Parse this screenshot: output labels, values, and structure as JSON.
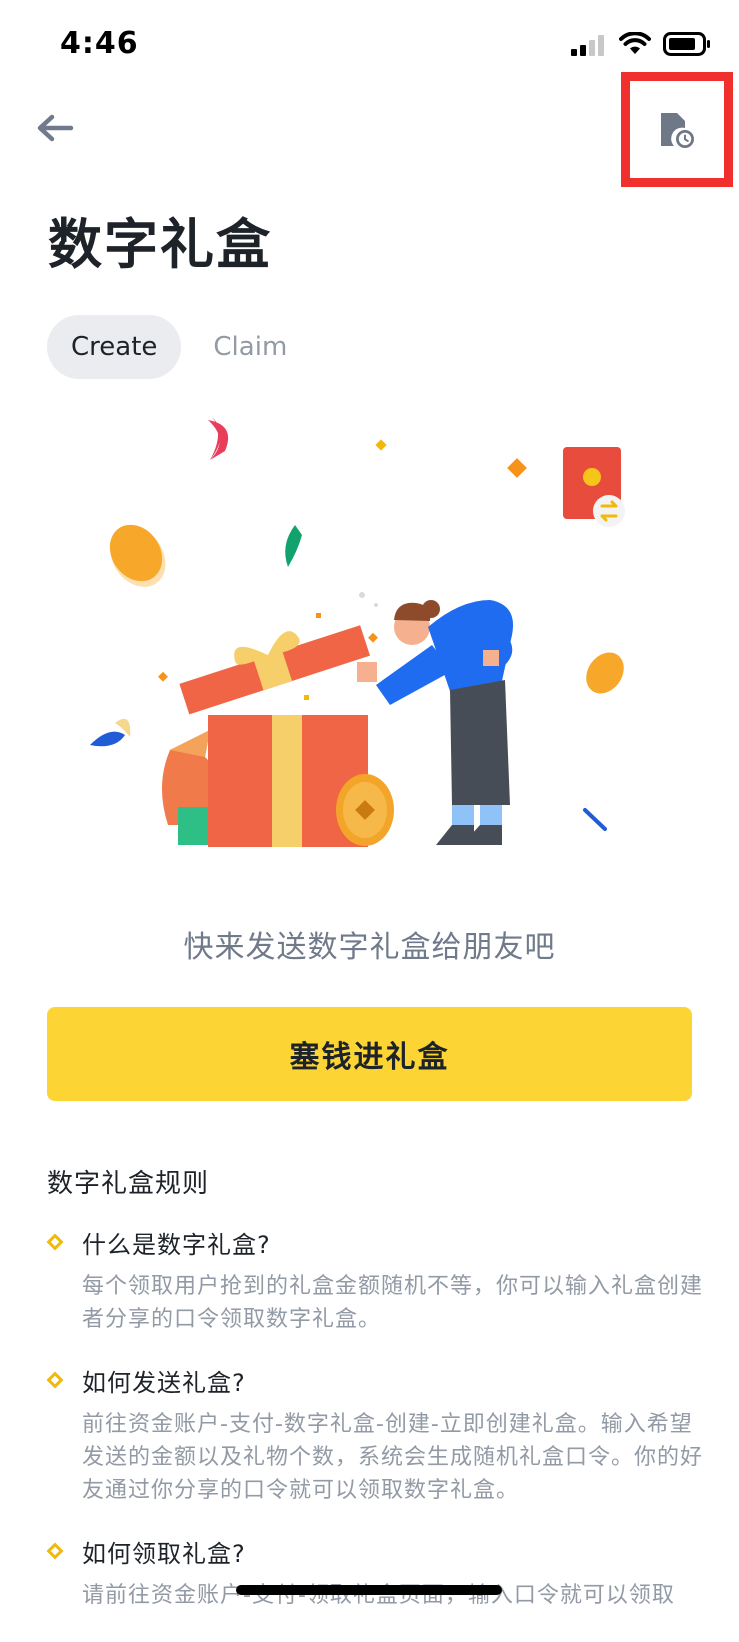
{
  "status_bar": {
    "time": "4:46"
  },
  "header": {
    "back_icon": "arrow-left-icon",
    "history_icon": "document-clock-icon",
    "highlight_color": "#f0302c"
  },
  "page": {
    "title": "数字礼盒"
  },
  "tabs": [
    {
      "label": "Create",
      "active": true
    },
    {
      "label": "Claim",
      "active": false
    }
  ],
  "promo_text": "快来发送数字礼盒给朋友吧",
  "primary_button": {
    "label": "塞钱进礼盒",
    "color": "#fcd535"
  },
  "rules": {
    "title": "数字礼盒规则",
    "items": [
      {
        "question": "什么是数字礼盒?",
        "answer": "每个领取用户抢到的礼盒金额随机不等，你可以输入礼盒创建者分享的口令领取数字礼盒。"
      },
      {
        "question": "如何发送礼盒?",
        "answer": "前往资金账户-支付-数字礼盒-创建-立即创建礼盒。输入希望发送的金额以及礼物个数，系统会生成随机礼盒口令。你的好友通过你分享的口令就可以领取数字礼盒。"
      },
      {
        "question": "如何领取礼盒?",
        "answer": "请前往资金账户-支付-领取礼盒页面，输入口令就可以领取"
      }
    ]
  }
}
